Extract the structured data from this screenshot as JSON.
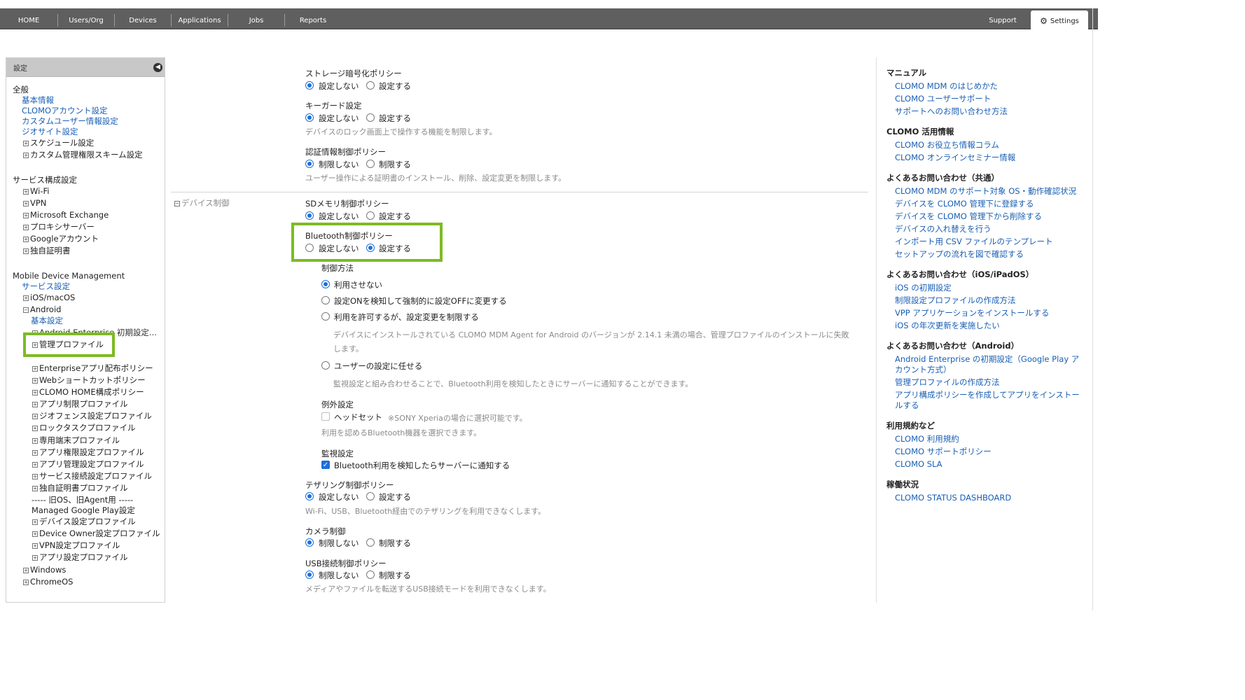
{
  "nav": {
    "items": [
      "HOME",
      "Users/Org",
      "Devices",
      "Applications",
      "Jobs",
      "Reports"
    ],
    "support": "Support",
    "settings": "Settings"
  },
  "sidebar": {
    "title": "設定",
    "general": "全般",
    "general_links": [
      "基本情報",
      "CLOMOアカウント設定",
      "カスタムユーザー情報設定",
      "ジオサイト設定"
    ],
    "general_expand": [
      "スケジュール設定",
      "カスタム管理権限スキーム設定"
    ],
    "service_title": "サービス構成設定",
    "service_items": [
      "Wi-Fi",
      "VPN",
      "Microsoft Exchange",
      "プロキシサーバー",
      "Googleアカウント",
      "独自証明書"
    ],
    "mdm_title": "Mobile Device Management",
    "service_settings": "サービス設定",
    "ios": "iOS/macOS",
    "android": "Android",
    "basic_settings": "基本設定",
    "ae_init": "Android Enterprise 初期設定...",
    "mgmt_profile": "管理プロファイル",
    "android_items": [
      "Enterpriseアプリ配布ポリシー",
      "Webショートカットポリシー",
      "CLOMO HOME構成ポリシー",
      "アプリ制限プロファイル",
      "ジオフェンス設定プロファイル",
      "ロックタスクプロファイル",
      "専用端末プロファイル",
      "アプリ権限設定プロファイル",
      "アプリ管理設定プロファイル",
      "サービス接続設定プロファイル",
      "独自証明書プロファイル"
    ],
    "old_divider": "----- 旧OS、旧Agent用 -----",
    "managed_gp": "Managed Google Play設定",
    "old_items": [
      "デバイス設定プロファイル",
      "Device Owner設定プロファイル",
      "VPN設定プロファイル",
      "アプリ設定プロファイル"
    ],
    "windows": "Windows",
    "chromeos": "ChromeOS"
  },
  "main": {
    "storage_title": "ストレージ暗号化ポリシー",
    "storage_off": "設定しない",
    "storage_on": "設定する",
    "keyguard_title": "キーガード設定",
    "keyguard_off": "設定しない",
    "keyguard_on": "設定する",
    "keyguard_help": "デバイスのロック画面上で操作する機能を制限します。",
    "cred_title": "認証情報制御ポリシー",
    "cred_off": "制限しない",
    "cred_on": "制限する",
    "cred_help": "ユーザー操作による証明書のインストール、削除、設定変更を制限します。",
    "section_name": "デバイス制御",
    "sd_title": "SDメモリ制御ポリシー",
    "sd_off": "設定しない",
    "sd_on": "設定する",
    "bt_title": "Bluetooth制御ポリシー",
    "bt_off": "設定しない",
    "bt_on": "設定する",
    "ctrl_method": "制御方法",
    "opt1": "利用させない",
    "opt2": "設定ONを検知して強制的に設定OFFに変更する",
    "opt3": "利用を許可するが、設定変更を制限する",
    "opt3_help_1": "デバイスにインストールされている CLOMO MDM Agent for Android のバージョンが 2.14.1 未満の場合、管理プロファイルのインストールに失敗",
    "opt3_help_2": "します。",
    "opt4": "ユーザーの設定に任せる",
    "opt4_help": "監視設定と組み合わせることで、Bluetooth利用を検知したときにサーバーに通知することができます。",
    "exc_title": "例外設定",
    "headset": "ヘッドセット",
    "headset_note": "※SONY Xperiaの場合に選択可能です。",
    "exc_help": "利用を認めるBluetooth機器を選択できます。",
    "mon_title": "監視設定",
    "mon_check": "Bluetooth利用を検知したらサーバーに通知する",
    "teth_title": "テザリング制御ポリシー",
    "teth_off": "設定しない",
    "teth_on": "設定する",
    "teth_help": "Wi-Fi、USB、Bluetooth経由でのテザリングを利用できなくします。",
    "cam_title": "カメラ制御",
    "cam_off": "制限しない",
    "cam_on": "制限する",
    "usb_title": "USB接続制御ポリシー",
    "usb_off": "制限しない",
    "usb_on": "制限する",
    "usb_help": "メディアやファイルを転送するUSB接続モードを利用できなくします。"
  },
  "right": {
    "manual": "マニュアル",
    "manual_links": [
      "CLOMO MDM のはじめかた",
      "CLOMO ユーザーサポート",
      "サポートへのお問い合わせ方法"
    ],
    "info": "CLOMO 活用情報",
    "info_links": [
      "CLOMO お役立ち情報コラム",
      "CLOMO オンラインセミナー情報"
    ],
    "faq_common": "よくあるお問い合わせ（共通）",
    "faq_common_links": [
      "CLOMO MDM のサポート対象 OS・動作確認状況",
      "デバイスを CLOMO 管理下に登録する",
      "デバイスを CLOMO 管理下から削除する",
      "デバイスの入れ替えを行う",
      "インポート用 CSV ファイルのテンプレート",
      "セットアップの流れを図で確認する"
    ],
    "faq_ios": "よくあるお問い合わせ（iOS/iPadOS）",
    "faq_ios_links": [
      "iOS の初期設定",
      "制限設定プロファイルの作成方法",
      "VPP アプリケーションをインストールする",
      "iOS の年次更新を実施したい"
    ],
    "faq_android": "よくあるお問い合わせ（Android）",
    "faq_android_l1a": "Android Enterprise の初期設定（Google Play ア",
    "faq_android_l1b": "カウント方式）",
    "faq_android_l2": "管理プロファイルの作成方法",
    "faq_android_l3a": "アプリ構成ポリシーを作成してアプリをインストー",
    "faq_android_l3b": "ルする",
    "terms": "利用規約など",
    "terms_links": [
      "CLOMO 利用規約",
      "CLOMO サポートポリシー",
      "CLOMO SLA"
    ],
    "status": "稼働状況",
    "status_link": "CLOMO STATUS DASHBOARD"
  },
  "colors": {
    "highlight": "#7dbb23",
    "link": "#1a5fb4",
    "radio": "#1e6fd9",
    "nav": "#5f5f5f"
  }
}
